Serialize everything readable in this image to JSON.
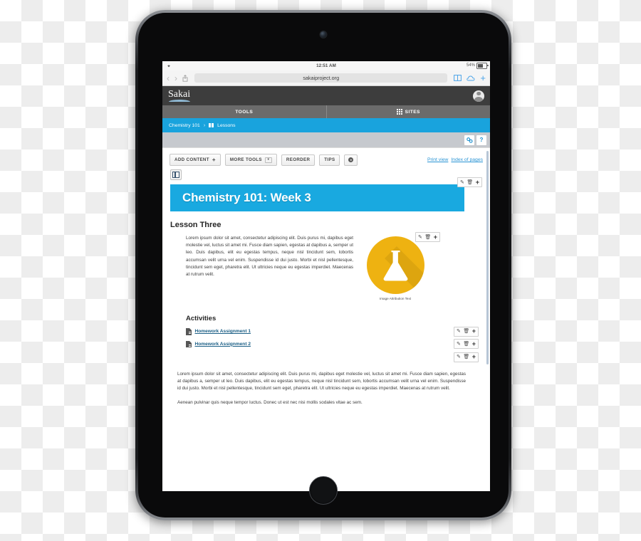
{
  "status_bar": {
    "time": "12:51 AM",
    "battery_percent": "54%",
    "wifi_icon": "wifi-icon"
  },
  "browser": {
    "back_icon": "chevron-left-icon",
    "forward_icon": "chevron-right-icon",
    "share_icon": "share-icon",
    "url": "sakaiproject.org",
    "bookmarks_icon": "book-icon",
    "cloud_icon": "cloud-icon",
    "new_tab_icon": "plus-icon"
  },
  "header": {
    "logo_text": "Sakai",
    "avatar": "user-avatar"
  },
  "nav": {
    "tools_label": "TOOLS",
    "sites_label": "SITES",
    "sites_icon": "grid-icon"
  },
  "breadcrumb": {
    "site": "Chemistry 101",
    "separator": "›",
    "tool_icon": "book-icon",
    "tool": "Lessons"
  },
  "utility_strip": {
    "link_icon": "link-icon",
    "help_icon": "question-mark-icon",
    "help_label": "?"
  },
  "toolbar": {
    "add_content": "ADD CONTENT",
    "add_content_plus": "➕",
    "more_tools": "MORE TOOLS",
    "more_tools_caret": "▾",
    "reorder": "REORDER",
    "tips": "TIPS",
    "settings_icon": "gear-icon",
    "print_view": "Print view",
    "index_of_pages": "Index of pages"
  },
  "page": {
    "columns_icon": "columns-layout-icon",
    "banner_title": "Chemistry 101: Week 3",
    "lesson_heading": "Lesson Three",
    "paragraph_1": "Lorem ipsum dolor sit amet, consectetur adipiscing elit. Duis purus mi, dapibus eget molestie vel, luctus sit amet mi. Fusce diam sapien, egestas at dapibus a, semper ut leo. Duis dapibus, elit eu egestas tempus, neque nisl tincidunt sem, lobortis accumsan velit urna vel enim. Suspendisse id dui justo. Morbi et nisl pellentesque, tincidunt sem eget, pharetra elit. Ut ultricies neque eu egestas imperdiet. Maecenas at rutrum velit.",
    "image_icon": "flask-icon",
    "image_caption": "Image Attribution Text",
    "activities_heading": "Activities",
    "activities": [
      {
        "icon": "document-icon",
        "label": "Homework Assignment 1"
      },
      {
        "icon": "document-icon",
        "label": "Homework Assignment 2"
      }
    ],
    "paragraph_2": "Lorem ipsum dolor sit amet, consectetur adipiscing elit. Duis purus mi, dapibus eget molestie vel, luctus sit amet mi. Fusce diam sapien, egestas at dapibus a, semper ut leo. Duis dapibus, elit eu egestas tempus, neque nisl tincidunt sem, lobortis accumsan velit urna vel enim. Suspendisse id dui justo. Morbi et nisl pellentesque, tincidunt sem eget, pharetra elit. Ut ultricies neque eu egestas imperdiet. Maecenas at rutrum velit.",
    "paragraph_3": "Aenean pulvinar quis neque tempor luctus. Donec ut est nec nisi mollis sodales vitae ac sem."
  },
  "item_controls": {
    "edit_icon": "✎",
    "delete_icon": "Ὕ1",
    "add_icon": "+"
  },
  "colors": {
    "accent_blue": "#19a9e0",
    "breadcrumb_blue": "#19a3dd",
    "link_blue": "#2893d4",
    "flask_yellow": "#eeb211",
    "header_gray": "#3d3d3d",
    "nav_gray": "#6b6b6b"
  }
}
